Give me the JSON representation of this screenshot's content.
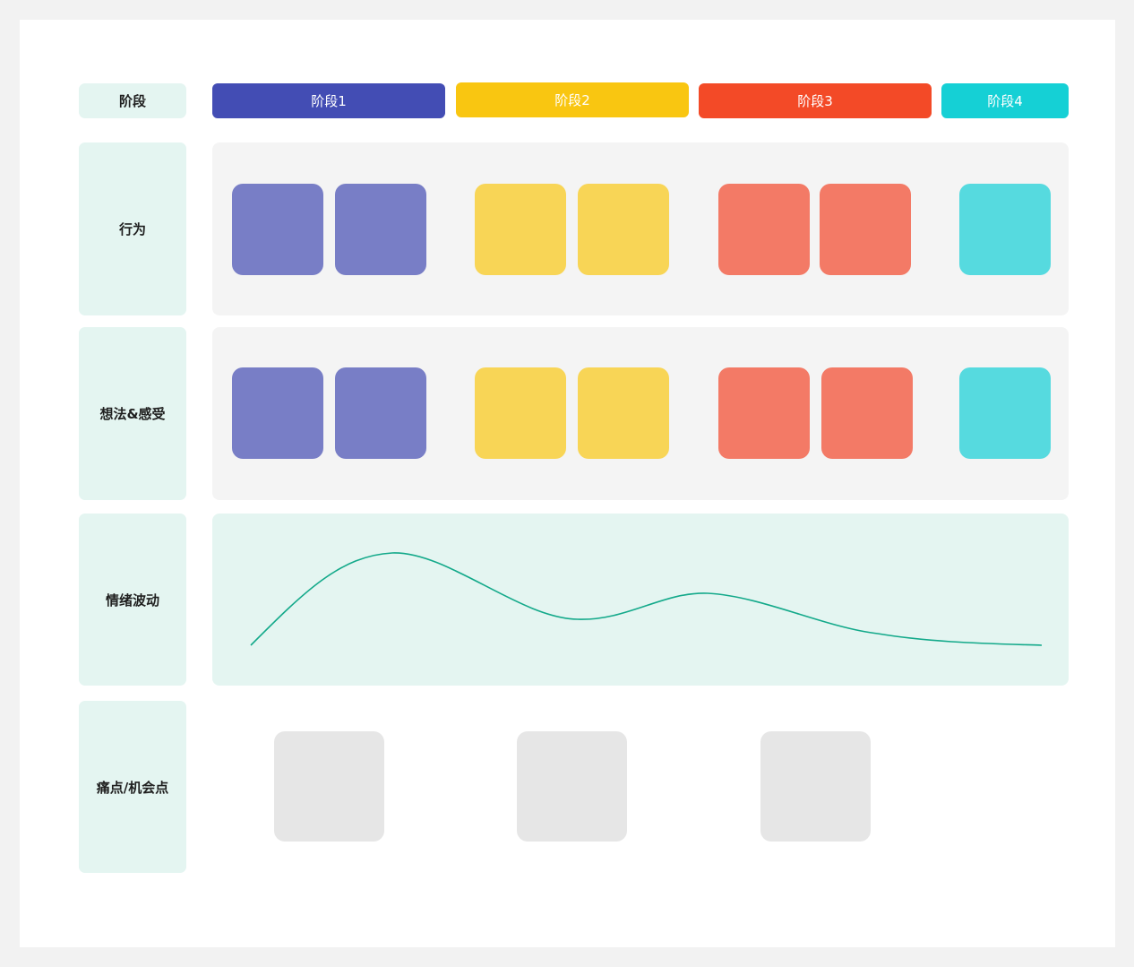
{
  "rows": {
    "stage": "阶段",
    "behavior": "行为",
    "thoughts": "想法&感受",
    "emotion": "情绪波动",
    "pain_points": "痛点/机会点"
  },
  "stages": [
    {
      "label": "阶段1",
      "color": "#434db4"
    },
    {
      "label": "阶段2",
      "color": "#f9c611"
    },
    {
      "label": "阶段3",
      "color": "#f34a27"
    },
    {
      "label": "阶段4",
      "color": "#15d0d5"
    }
  ],
  "card_colors": {
    "stage1": "#787ec6",
    "stage2": "#f8d556",
    "stage3": "#f37a66",
    "stage4": "#56dadf",
    "pain_point": "#e6e6e6",
    "emotion_line": "#13a98a"
  }
}
